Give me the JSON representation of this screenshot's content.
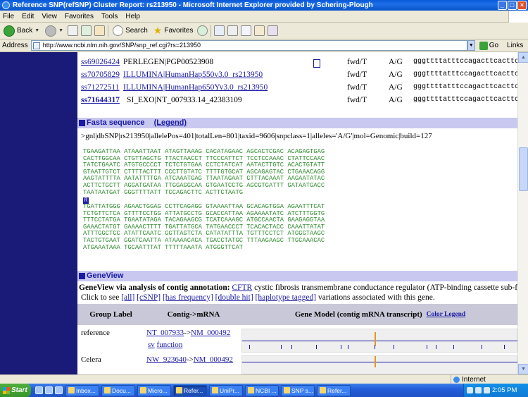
{
  "window": {
    "title": "Reference SNP(refSNP) Cluster Report: rs213950 - Microsoft Internet Explorer provided by Schering-Plough",
    "controls": [
      "_",
      "□",
      "×"
    ]
  },
  "menu": [
    "File",
    "Edit",
    "View",
    "Favorites",
    "Tools",
    "Help"
  ],
  "toolbar": {
    "back": "Back",
    "search": "Search",
    "favorites": "Favorites"
  },
  "address": {
    "label": "Address",
    "url": "http://www.ncbi.nlm.nih.gov/SNP/snp_ref.cgi?rs=213950",
    "go": "Go",
    "links": "Links"
  },
  "ss_rows": [
    {
      "ss": "ss69026424",
      "handle": "PERLEGEN|PGP00523908",
      "handle_link": false,
      "orient": "fwd/T",
      "allele": "A/G",
      "seq": "gggttttatttccagacttcacttc"
    },
    {
      "ss": "ss70705829",
      "handle": "ILLUMINA|HumanHap550v3.0_rs213950",
      "handle_link": true,
      "orient": "fwd/T",
      "allele": "A/G",
      "seq": "gggttttatttccagacttcacttc"
    },
    {
      "ss": "ss71272511",
      "handle": "ILLUMINA|HumanHap650Yv3.0_rs213950",
      "handle_link": true,
      "orient": "fwd/T",
      "allele": "A/G",
      "seq": "gggttttatttccagacttcacttc"
    },
    {
      "ss": "ss71644317",
      "handle": "SI_EXO|NT_007933.14_42383109",
      "handle_link": false,
      "orient": "fwd/T",
      "allele": "A/G",
      "seq": "gggttttatttccagacttcacttc"
    }
  ],
  "fasta": {
    "title": "Fasta sequence",
    "legend": "(Legend)",
    "header": ">gnl|dbSNP|rs213950|allelePos=401|totalLen=801|taxid=9606|snpclass=1|alleles='A/G'|mol=Genomic|build=127",
    "seq5": "TGAAGATTAA ATAAATTAAT ATAGTTAAAG CACATAGAAC AGCACTCGAC ACAGAGTGAG\nCACTTGGCAA CTGTTAGCTG TTACTAACCT TTCCCATTCT TCCTCCAAAC CTATTCCAAC\nTATCTGAATC ATGTGCCCCT TCTCTGTGAA CCTCTATCAT AATACTTGTC ACACTGTATT\nGTAATTGTCT CTTTTACTTT CCCTTGTATC TTTTGTGCAT AGCAGAGTAC CTGAAACAGG\nAAGTATTTTA AATATTTTGA ATCAAATGAG TTAATAGAAT CTTTACAAAT AAGAATATAC\nACTTCTGCTT AGGATGATAA TTGGAGGCAA GTGAATCCTG AGCGTGATTT GATAATGACC\nTAATAATGAT GGGTTTTATT TCCAGACTTC ACTTCTAATG",
    "allele_code": "R",
    "seq3": "TGATTATGGG AGAACTGGAG CCTTCAGAGG GTAAAATTAA GCACAGTGGA AGAATTTCAT\nTCTGTTCTCA GTTTTCCTGG ATTATGCCTG GCACCATTAA AGAAAATATC ATCTTTGGTG\nTTTCCTATGA TGAATATAGA TACAGAAGCG TCATCAAAGC ATGCCAACTA GAAGAGGTAA\nGAAACTATGT GAAAACTTTT TGATTATGCA TATGAACCCT TCACACTACC CAAATTATAT\nATTTGGCTCC ATATTCAATC GGTTAGTCTA CATATATTTA TGTTTCCTCT ATGGGTAAGC\nTACTGTGAAT GGATCAATTA ATAAAACACA TGACCTATGC TTTAAGAAGC TTGCAAACAC\nATGAAATAAA TGCAATTTAT TTTTTAAATA ATGGGTTCAT"
  },
  "geneview": {
    "title": "GeneView",
    "line1_bold": "GeneView via analysis of contig annotation:",
    "gene_symbol": "CFTR",
    "gene_desc": "cystic fibrosis transmembrane conductance regulator (ATP-binding cassette sub-family",
    "line2_prefix": "Click to see",
    "links": [
      "[all]",
      "[cSNP]",
      "[has frequency]",
      "[double hit]",
      "[haplotype tagged]"
    ],
    "line2_suffix": "variations associated with this gene.",
    "col_group": "Group Label",
    "col_contig": "Contig->mRNA",
    "col_model": "Gene Model (contig mRNA transcript)",
    "color_legend": "Color Legend",
    "rows": [
      {
        "label": "reference",
        "contig": "NT_007933",
        "arrow": "->",
        "mrna": "NM_000492",
        "sv": "sv",
        "func": "function"
      },
      {
        "label": "Celera",
        "contig": "NW_923640",
        "arrow": "->",
        "mrna": "NM_000492"
      }
    ]
  },
  "status": {
    "zone": "Internet"
  },
  "taskbar": {
    "start": "Start",
    "tasks": [
      "Inbox...",
      "Docu...",
      "Micro...",
      "Refer...",
      "UniPr...",
      "NCBI ...",
      "SNP s...",
      "Refer..."
    ],
    "clock": "2:05 PM"
  }
}
